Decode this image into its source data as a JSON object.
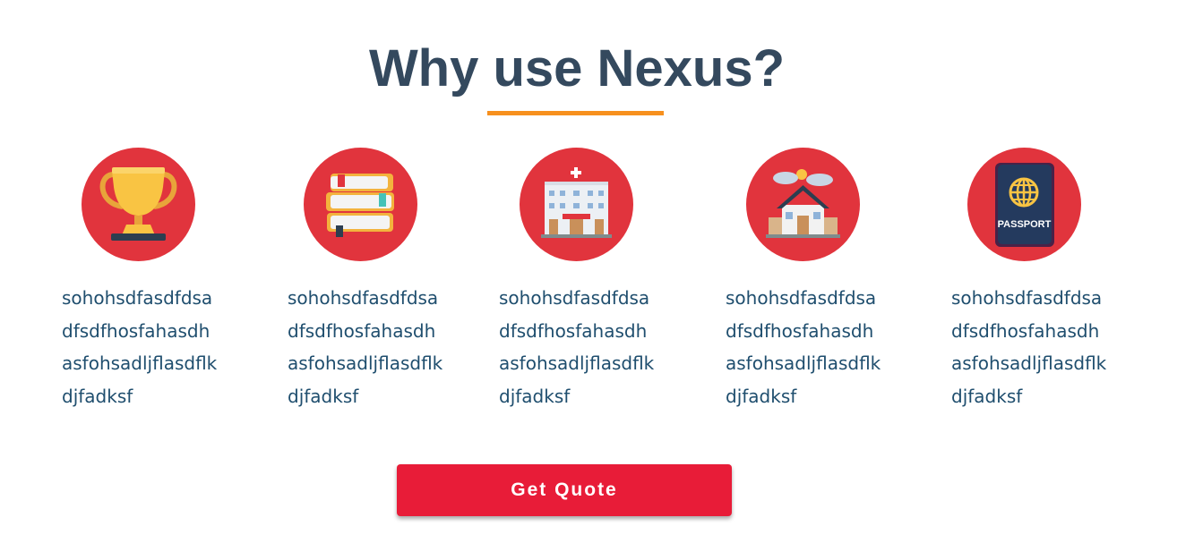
{
  "header": {
    "title": "Why use Nexus?"
  },
  "features": [
    {
      "icon": "trophy-icon",
      "text": "sohohsdfasdfdsa\ndfsdfhosfahasdh\nasfohsadljflasdflk\ndjfadksf"
    },
    {
      "icon": "books-icon",
      "text": "sohohsdfasdfdsa\ndfsdfhosfahasdh\nasfohsadljflasdflk\ndjfadksf"
    },
    {
      "icon": "hospital-icon",
      "text": "sohohsdfasdfdsa\ndfsdfhosfahasdh\nasfohsadljflasdflk\ndjfadksf"
    },
    {
      "icon": "house-icon",
      "text": "sohohsdfasdfdsa\ndfsdfhosfahasdh\nasfohsadljflasdflk\ndjfadksf"
    },
    {
      "icon": "passport-icon",
      "text": "sohohsdfasdfdsa\ndfsdfhosfahasdh\nasfohsadljflasdflk\ndjfadksf",
      "icon_label": "PASSPORT"
    }
  ],
  "cta": {
    "label": "Get Quote"
  },
  "colors": {
    "title": "#34495e",
    "accent_underline": "#f7901e",
    "icon_circle": "#e1343d",
    "body_text": "#1f4e6e",
    "button": "#e81c38"
  }
}
